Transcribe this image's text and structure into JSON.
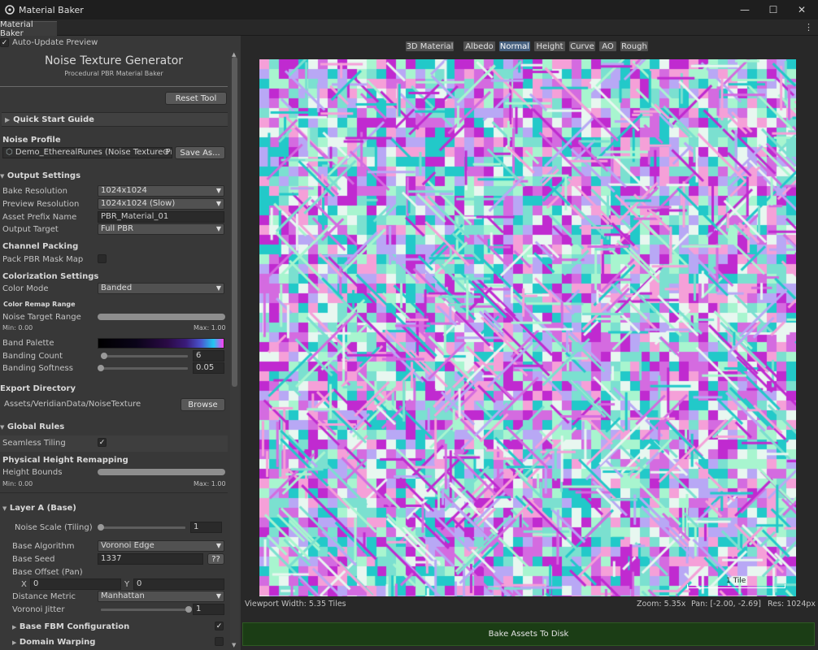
{
  "window": {
    "title": "Material Baker",
    "tab_label": "Material Baker",
    "minimize_glyph": "—",
    "maximize_glyph": "☐",
    "close_glyph": "✕",
    "menu_glyph": "⋮"
  },
  "panel": {
    "auto_update_label": "Auto-Update Preview",
    "auto_update_checked": true,
    "heading": "Noise Texture Generator",
    "subheading": "Procedural PBR Material Baker",
    "reset_button": "Reset Tool",
    "quick_start": "Quick Start Guide",
    "noise_profile": {
      "label": "Noise Profile",
      "value": "Demo_EtherealRunes (Noise Texture Profi",
      "save_button": "Save As..."
    },
    "output_settings": {
      "title": "Output Settings",
      "bake_resolution_label": "Bake Resolution",
      "bake_resolution_value": "1024x1024",
      "preview_resolution_label": "Preview Resolution",
      "preview_resolution_value": "1024x1024 (Slow)",
      "asset_prefix_label": "Asset Prefix Name",
      "asset_prefix_value": "PBR_Material_01",
      "output_target_label": "Output Target",
      "output_target_value": "Full PBR"
    },
    "channel_packing": {
      "title": "Channel Packing",
      "pack_label": "Pack PBR Mask Map",
      "pack_checked": false
    },
    "colorization": {
      "title": "Colorization Settings",
      "color_mode_label": "Color Mode",
      "color_mode_value": "Banded",
      "remap_title": "Color Remap Range",
      "noise_target_label": "Noise Target Range",
      "noise_target_min": "Min: 0.00",
      "noise_target_max": "Max: 1.00",
      "band_palette_label": "Band Palette",
      "banding_count_label": "Banding Count",
      "banding_count_value": "6",
      "banding_count_fraction": 0.04,
      "banding_softness_label": "Banding Softness",
      "banding_softness_value": "0.05",
      "banding_softness_fraction": 0.0
    },
    "export": {
      "title": "Export Directory",
      "path": "Assets/VeridianData/NoiseTexture",
      "browse_button": "Browse"
    },
    "global_rules": {
      "title": "Global Rules",
      "seamless_label": "Seamless Tiling",
      "seamless_checked": true
    },
    "height_remap": {
      "title": "Physical Height Remapping",
      "bounds_label": "Height Bounds",
      "min": "Min: 0.00",
      "max": "Max: 1.00"
    },
    "layer_a": {
      "title": "Layer A (Base)",
      "noise_scale_label": "Noise Scale (Tiling)",
      "noise_scale_value": "1",
      "noise_scale_fraction": 0.0,
      "algorithm_label": "Base Algorithm",
      "algorithm_value": "Voronoi Edge",
      "seed_label": "Base Seed",
      "seed_value": "1337",
      "seed_button": "??",
      "offset_label": "Base Offset (Pan)",
      "offset_x_label": "X",
      "offset_x_value": "0",
      "offset_y_label": "Y",
      "offset_y_value": "0",
      "distance_label": "Distance Metric",
      "distance_value": "Manhattan",
      "jitter_label": "Voronoi Jitter",
      "jitter_value": "1",
      "jitter_fraction": 1.0,
      "fbm_label": "Base FBM Configuration",
      "fbm_checked": true,
      "warp_label": "Domain Warping",
      "warp_checked": false
    }
  },
  "viewport": {
    "tabs": [
      "3D Material",
      "Albedo",
      "Normal",
      "Height",
      "Curve",
      "AO",
      "Rough"
    ],
    "active_tab": "Normal",
    "scale_label": "1 Tile",
    "width_text": "Viewport Width: 5.35 Tiles",
    "zoom_text": "Zoom: 5.35x",
    "pan_text": "Pan: [-2.00, -2.69]",
    "res_text": "Res: 1024px",
    "bake_button": "Bake Assets To Disk"
  },
  "colors": {
    "accent_tab": "#46607f",
    "bake_green": "#1b3d15",
    "normal_pink": "#f5a0d8",
    "normal_magenta": "#c02ad0",
    "normal_cyan": "#22c9c9",
    "normal_mint": "#a8f5cf",
    "normal_lavender": "#b8a8f5"
  }
}
